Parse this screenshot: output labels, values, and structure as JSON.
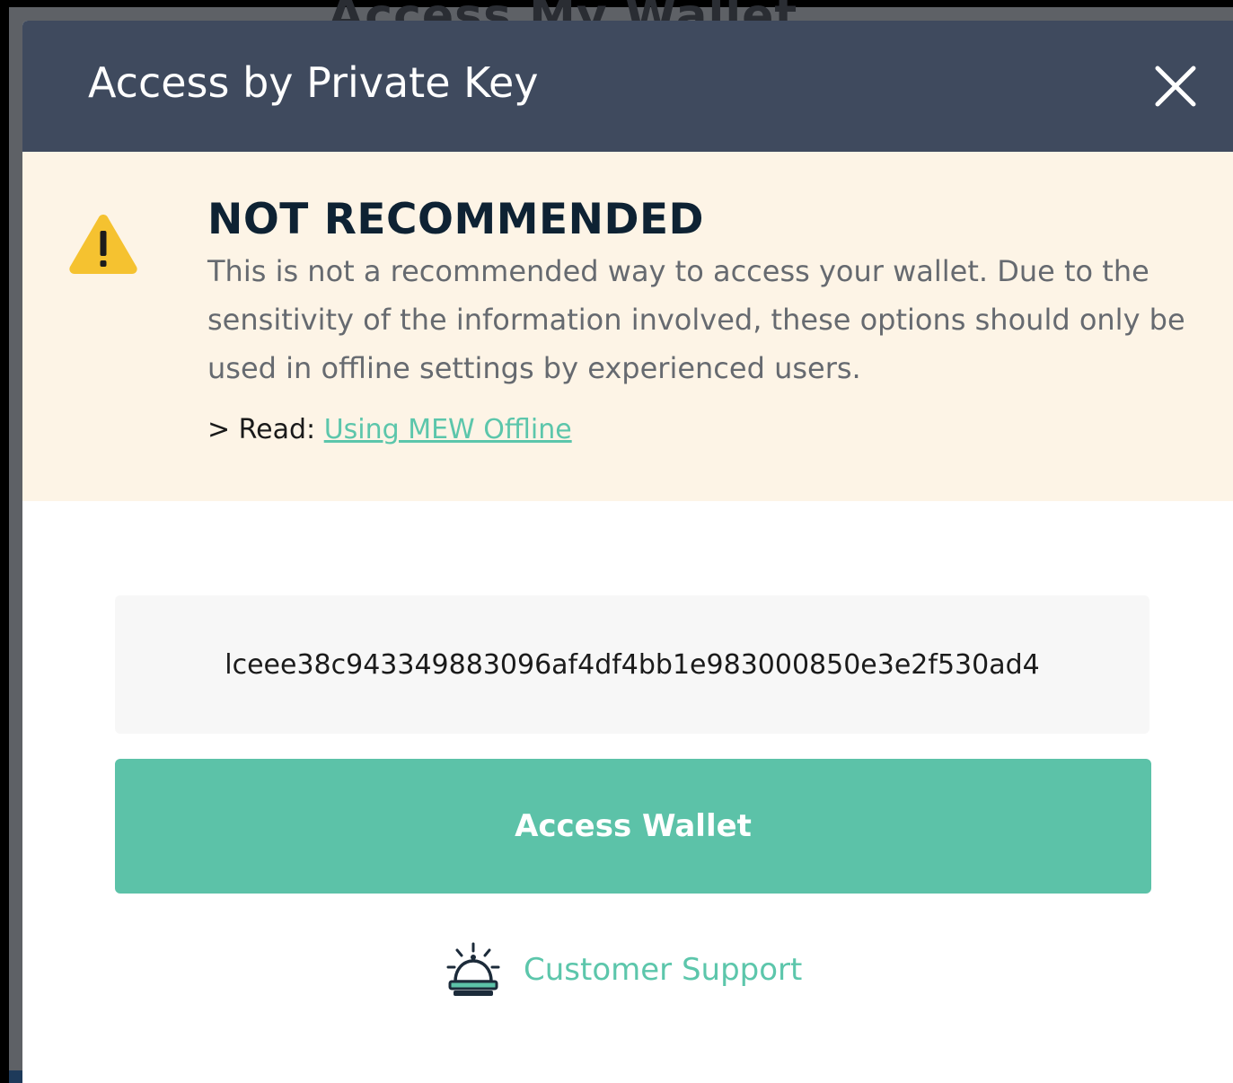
{
  "background": {
    "title": "Access My Wallet"
  },
  "modal": {
    "title": "Access by Private Key",
    "close_icon": "close-icon"
  },
  "warning": {
    "icon": "warning-triangle-icon",
    "heading": "NOT RECOMMENDED",
    "body": "This is not a recommended way to access your wallet. Due to the sensitivity of the information involved, these options should only be used in offline settings by experienced users.",
    "read_prefix": "> Read: ",
    "read_link": "Using MEW Offline"
  },
  "private_key": {
    "value": "lceee38c943349883096af4df4bb1e983000850e3e2f530ad4"
  },
  "access_button": {
    "label": "Access Wallet"
  },
  "support": {
    "icon": "service-bell-icon",
    "label": "Customer Support"
  },
  "colors": {
    "header_bg": "#3f4a5e",
    "warning_bg": "#fdf4e6",
    "accent": "#5cc2a8",
    "warning_icon": "#f5c230"
  }
}
